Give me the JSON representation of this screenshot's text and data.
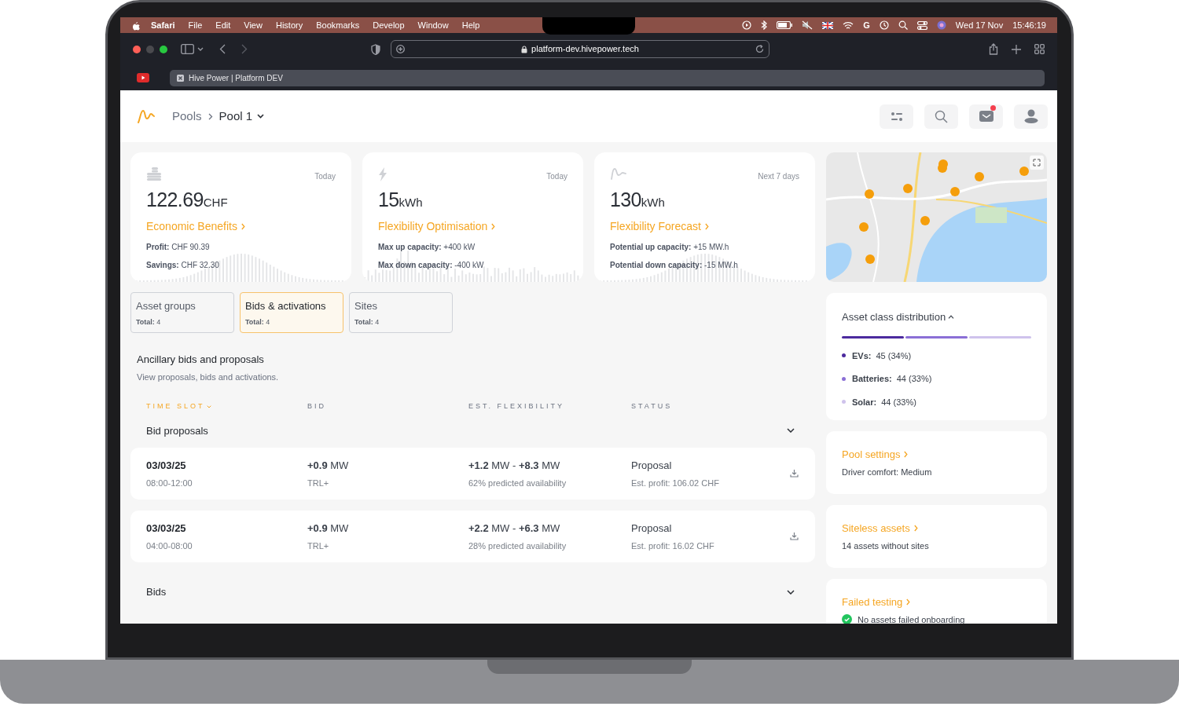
{
  "menu_bar": {
    "app": "Safari",
    "items": [
      "File",
      "Edit",
      "View",
      "History",
      "Bookmarks",
      "Develop",
      "Window",
      "Help"
    ],
    "status_text": "G",
    "date": "Wed 17 Nov",
    "time": "15:46:19"
  },
  "browser": {
    "url": "platform-dev.hivepower.tech",
    "tab_title": "Hive Power | Platform DEV"
  },
  "header": {
    "breadcrumb": [
      "Pools",
      "Pool 1"
    ],
    "unread_messages": true
  },
  "stat_cards": [
    {
      "period": "Today",
      "value": "122.69",
      "unit": "CHF",
      "link": "Economic Benefits",
      "details": [
        "**Profit:** CHF 90.39",
        "**Savings:** CHF 32.30"
      ]
    },
    {
      "period": "Today",
      "value": "15",
      "unit": "kWh",
      "link": "Flexibility Optimisation",
      "details": [
        "**Max up capacity:** +400 kW",
        "**Max down capacity:** -400 kW"
      ]
    },
    {
      "period": "Next 7 days",
      "value": "130",
      "unit": "kWh",
      "link": "Flexibility Forecast",
      "details": [
        "**Potential up capacity:** +15 MW.h",
        "**Potential down capacity:** -15 MW.h"
      ]
    }
  ],
  "tabs": [
    {
      "label": "Asset groups",
      "total": "**Total:** 4",
      "selected": false
    },
    {
      "label": "Bids & activations",
      "total": "**Total:** 4",
      "selected": true
    },
    {
      "label": "Sites",
      "total": "**Total:** 4",
      "selected": false
    }
  ],
  "section": {
    "title": "Ancillary bids and proposals",
    "subtitle": "View proposals, bids and activations."
  },
  "table": {
    "columns": [
      {
        "label": "TIME SLOT",
        "sorted": true
      },
      {
        "label": "BID",
        "sorted": false
      },
      {
        "label": "EST. FLEXIBILITY",
        "sorted": false
      },
      {
        "label": "STATUS",
        "sorted": false
      }
    ],
    "groups": [
      {
        "title": "Bid proposals",
        "rows": [
          {
            "date": "03/03/25",
            "time": "08:00-12:00",
            "bid": "**+0.9** MW",
            "product": "TRL+",
            "flexibility": "**+1.2** MW - **+8.3** MW",
            "availability": "62% predicted availability",
            "status": "Proposal",
            "profit": "Est. profit: 106.02 CHF"
          },
          {
            "date": "03/03/25",
            "time": "04:00-08:00",
            "bid": "**+0.9** MW",
            "product": "TRL+",
            "flexibility": "**+2.2** MW - **+6.3** MW",
            "availability": "28% predicted availability",
            "status": "Proposal",
            "profit": "Est. profit: 16.02 CHF"
          }
        ]
      },
      {
        "title": "Bids"
      }
    ]
  },
  "asset_distribution": {
    "title": "Asset class distribution",
    "expanded": true,
    "items": [
      {
        "label": "EVs:",
        "value": "45 (34%)",
        "color": "#4c2a9e"
      },
      {
        "label": "Batteries:",
        "value": "44 (33%)",
        "color": "#8b6fd6"
      },
      {
        "label": "Solar:",
        "value": "44 (33%)",
        "color": "#cfc3ec"
      }
    ]
  },
  "info_cards": [
    {
      "kind": "text",
      "title": "Pool settings",
      "text": "Driver comfort: Medium"
    },
    {
      "kind": "text",
      "title": "Siteless assets",
      "text": "14 assets without sites"
    },
    {
      "kind": "check",
      "title": "Failed testing",
      "text": "No assets failed onboarding"
    }
  ]
}
